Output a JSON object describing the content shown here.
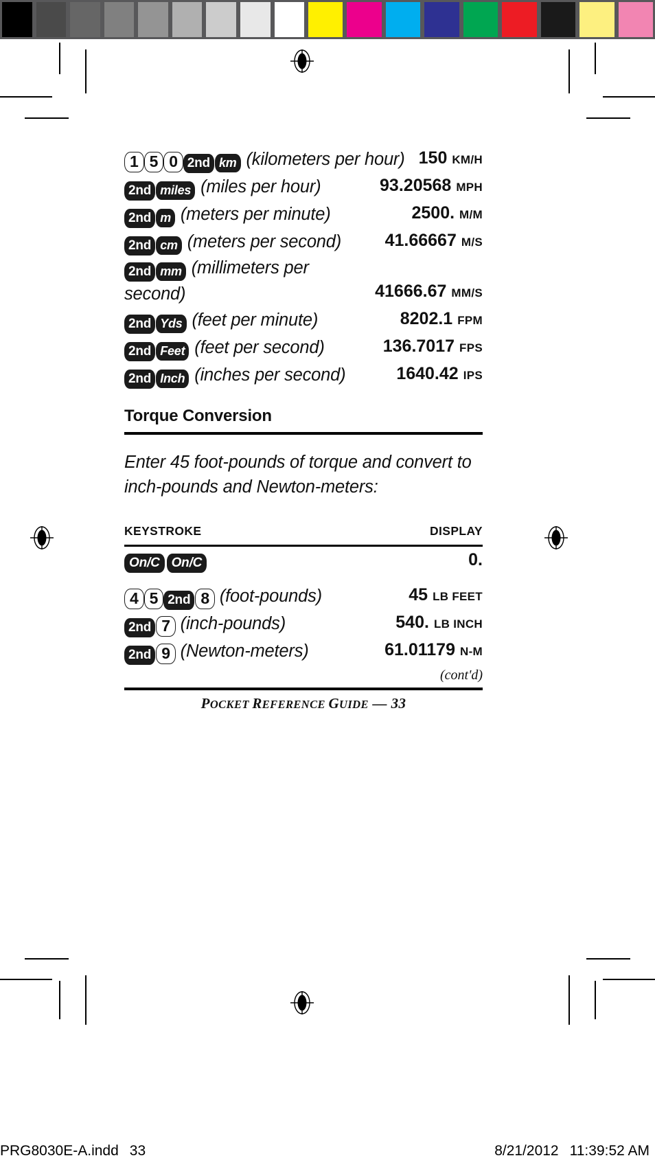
{
  "calibration_bar": {
    "grayscale": [
      "#000000",
      "#4a4a4a",
      "#666666",
      "#808080",
      "#949494",
      "#b0b0b0",
      "#cccccc",
      "#e8e8e8",
      "#ffffff"
    ],
    "colors": [
      "#fff000",
      "#ec008c",
      "#00aeef",
      "#2e3192",
      "#00a651",
      "#ed1c24",
      "#1a1a1a",
      "#fdf080",
      "#f285b2"
    ],
    "bar_background": "#58585a"
  },
  "speed_conversion_rows": [
    {
      "keys": [
        {
          "label": "1",
          "style": "light"
        },
        {
          "label": "5",
          "style": "light"
        },
        {
          "label": "0",
          "style": "light"
        },
        {
          "label": "2nd",
          "style": "dark"
        },
        {
          "label": "km",
          "style": "dark-ital"
        }
      ],
      "description": "(kilometers per hour)",
      "value": "150",
      "unit": "KM/H"
    },
    {
      "keys": [
        {
          "label": "2nd",
          "style": "dark"
        },
        {
          "label": "miles",
          "style": "dark-ital"
        }
      ],
      "description": "(miles per hour)",
      "value": "93.20568",
      "unit": "MPH"
    },
    {
      "keys": [
        {
          "label": "2nd",
          "style": "dark"
        },
        {
          "label": "m",
          "style": "dark-ital"
        }
      ],
      "description": "(meters per minute)",
      "value": "2500.",
      "unit": "M/M"
    },
    {
      "keys": [
        {
          "label": "2nd",
          "style": "dark"
        },
        {
          "label": "cm",
          "style": "dark-ital"
        }
      ],
      "description": "(meters per second)",
      "value": "41.66667",
      "unit": "M/S"
    },
    {
      "keys": [
        {
          "label": "2nd",
          "style": "dark"
        },
        {
          "label": "mm",
          "style": "dark-ital"
        }
      ],
      "description": "(millimeters per second)",
      "value": "41666.67",
      "unit": "MM/S"
    },
    {
      "keys": [
        {
          "label": "2nd",
          "style": "dark"
        },
        {
          "label": "Yds",
          "style": "dark-ital"
        }
      ],
      "description": "(feet per minute)",
      "value": "8202.1",
      "unit": "FPM"
    },
    {
      "keys": [
        {
          "label": "2nd",
          "style": "dark"
        },
        {
          "label": "Feet",
          "style": "dark-ital"
        }
      ],
      "description": "(feet per second)",
      "value": "136.7017",
      "unit": "FPS"
    },
    {
      "keys": [
        {
          "label": "2nd",
          "style": "dark"
        },
        {
          "label": "Inch",
          "style": "dark-ital"
        }
      ],
      "description": "(inches per second)",
      "value": "1640.42",
      "unit": "IPS"
    }
  ],
  "torque_section": {
    "heading": "Torque Conversion",
    "intro": "Enter 45 foot-pounds of torque and convert to inch-pounds and Newton-meters:",
    "table_headers": {
      "keystroke": "KEYSTROKE",
      "display": "DISPLAY"
    },
    "rows": [
      {
        "keys": [
          {
            "label": "On/C",
            "style": "dark-onc"
          },
          {
            "label": "On/C",
            "style": "dark-onc"
          }
        ],
        "description": "",
        "value": "0.",
        "unit": ""
      },
      {
        "keys": [
          {
            "label": "4",
            "style": "light"
          },
          {
            "label": "5",
            "style": "light"
          },
          {
            "label": "2nd",
            "style": "dark"
          },
          {
            "label": "8",
            "style": "light"
          }
        ],
        "description": "(foot-pounds)",
        "value": "45",
        "unit": "LB FEET"
      },
      {
        "keys": [
          {
            "label": "2nd",
            "style": "dark"
          },
          {
            "label": "7",
            "style": "light"
          }
        ],
        "description": "(inch-pounds)",
        "value": "540.",
        "unit": "LB INCH"
      },
      {
        "keys": [
          {
            "label": "2nd",
            "style": "dark"
          },
          {
            "label": "9",
            "style": "light"
          }
        ],
        "description": "(Newton-meters)",
        "value": "61.01179",
        "unit": "N-M"
      }
    ],
    "continued_note": "(cont'd)"
  },
  "footer": {
    "running_head_first": "P",
    "running_head_rest": "OCKET ",
    "running_head_second": "R",
    "running_head_rest2": "EFERENCE ",
    "running_head_third": "G",
    "running_head_rest3": "UIDE",
    "running_head_dash": " — ",
    "page_number": "33"
  },
  "production_slug": {
    "filename": "PRG8030E-A.indd",
    "page": "33",
    "date": "8/21/2012",
    "time": "11:39:52 AM"
  }
}
